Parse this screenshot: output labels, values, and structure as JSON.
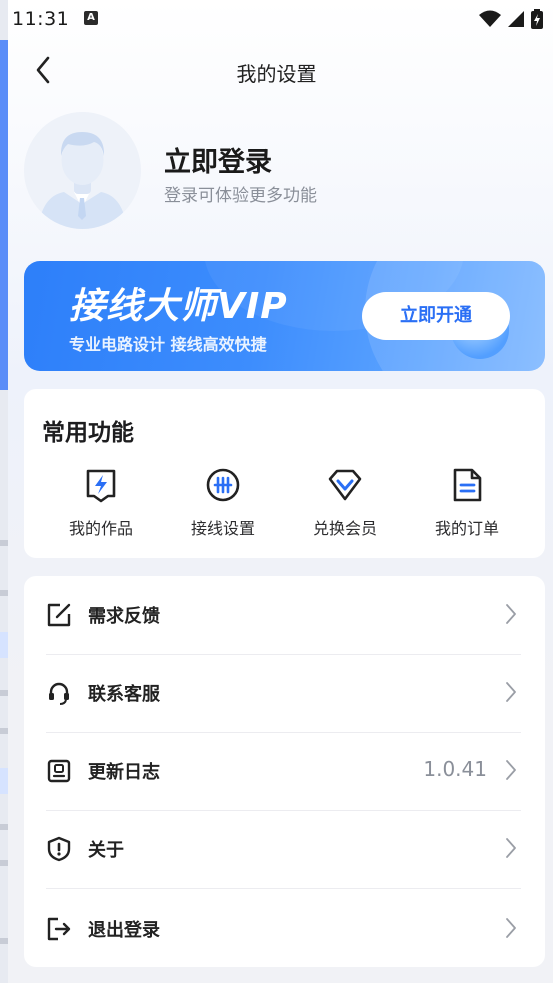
{
  "status": {
    "time": "11:31",
    "notif_glyph": "A"
  },
  "header": {
    "title": "我的设置"
  },
  "profile": {
    "login_title": "立即登录",
    "login_subtitle": "登录可体验更多功能"
  },
  "vip": {
    "title": "接线大师VIP",
    "subtitle": "专业电路设计  接线高效快捷",
    "button_label": "立即开通"
  },
  "functions": {
    "title": "常用功能",
    "items": [
      {
        "label": "我的作品",
        "icon": "lightning-doc-icon"
      },
      {
        "label": "接线设置",
        "icon": "wiring-icon"
      },
      {
        "label": "兑换会员",
        "icon": "diamond-icon"
      },
      {
        "label": "我的订单",
        "icon": "order-doc-icon"
      }
    ]
  },
  "list": {
    "items": [
      {
        "label": "需求反馈",
        "value": "",
        "icon": "edit-icon"
      },
      {
        "label": "联系客服",
        "value": "",
        "icon": "headset-icon"
      },
      {
        "label": "更新日志",
        "value": "1.0.41",
        "icon": "log-icon"
      },
      {
        "label": "关于",
        "value": "",
        "icon": "shield-info-icon"
      },
      {
        "label": "退出登录",
        "value": "",
        "icon": "logout-icon"
      }
    ]
  },
  "colors": {
    "accent": "#2d7ff9",
    "icon_blue": "#2a6ff5",
    "icon_dark": "#222222"
  }
}
